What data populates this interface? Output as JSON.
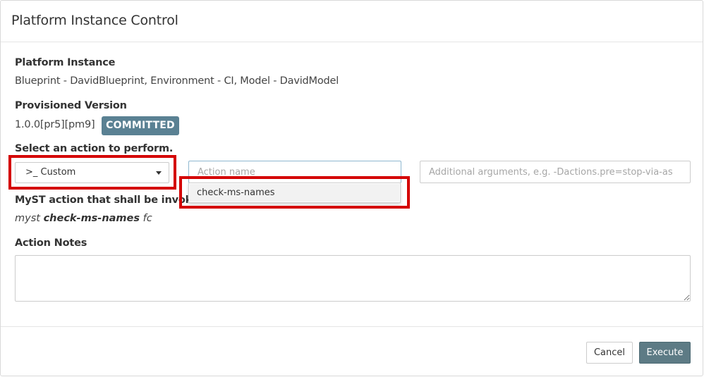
{
  "modal": {
    "title": "Platform Instance Control"
  },
  "platform_instance": {
    "label": "Platform Instance",
    "value": "Blueprint - DavidBlueprint, Environment - CI, Model - DavidModel"
  },
  "provisioned_version": {
    "label": "Provisioned Version",
    "value": "1.0.0[pr5][pm9]",
    "badge": "COMMITTED",
    "badge_color": "#5a8193"
  },
  "action": {
    "label": "Select an action to perform.",
    "type_select": {
      "selected": ">_ Custom"
    },
    "name_input": {
      "value": "",
      "placeholder": "Action name"
    },
    "args_input": {
      "value": "",
      "placeholder": "Additional arguments, e.g. -Dactions.pre=stop-via-as"
    },
    "suggestions": [
      "check-ms-names"
    ]
  },
  "invocation": {
    "label": "MyST action that shall be invoked:",
    "prefix": "myst ",
    "action": "check-ms-names",
    "suffix": " fc"
  },
  "notes": {
    "label": "Action Notes",
    "value": ""
  },
  "footer": {
    "cancel_label": "Cancel",
    "execute_label": "Execute",
    "execute_color": "#5d7b85"
  },
  "annotation_color": "#d40000"
}
